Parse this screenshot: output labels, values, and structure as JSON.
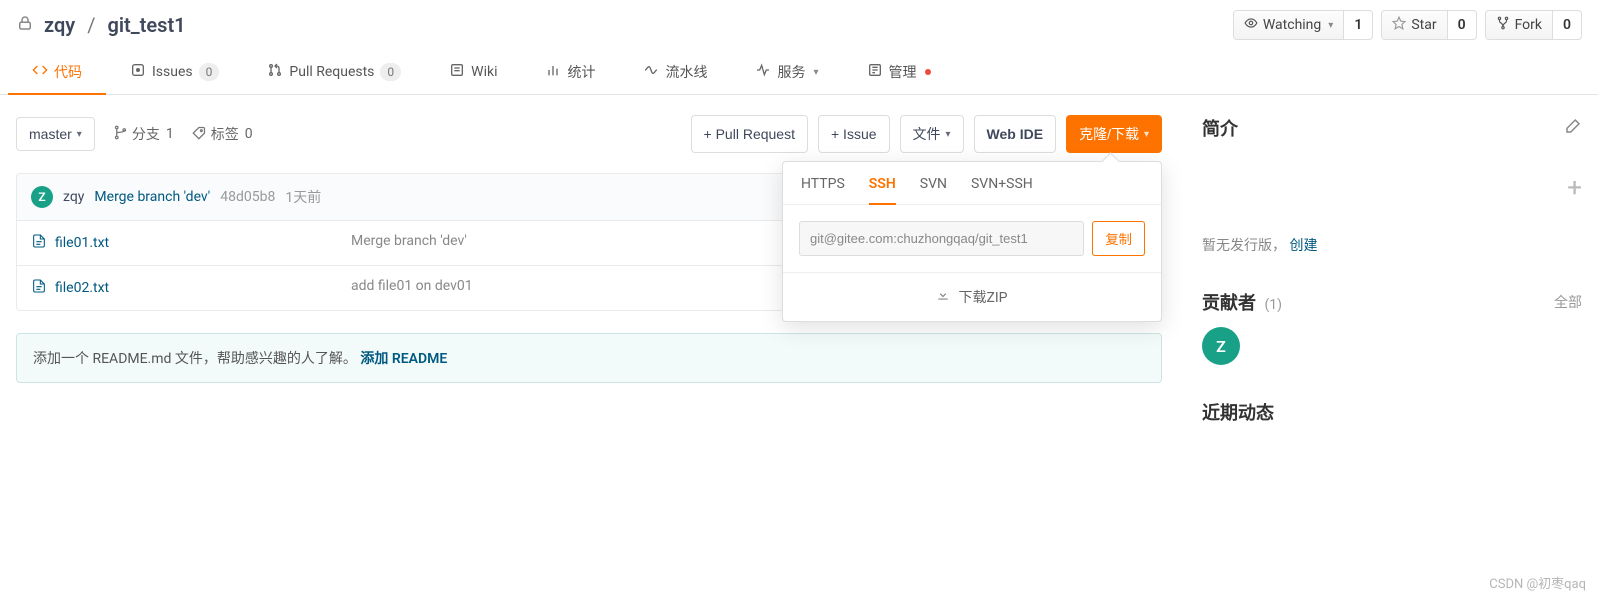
{
  "repo": {
    "owner": "zqy",
    "name": "git_test1"
  },
  "actions": {
    "watch": {
      "label": "Watching",
      "count": "1"
    },
    "star": {
      "label": "Star",
      "count": "0"
    },
    "fork": {
      "label": "Fork",
      "count": "0"
    }
  },
  "tabs": {
    "code": "代码",
    "issues": {
      "label": "Issues",
      "count": "0"
    },
    "pr": {
      "label": "Pull Requests",
      "count": "0"
    },
    "wiki": "Wiki",
    "stats": "统计",
    "pipeline": "流水线",
    "services": "服务",
    "manage": "管理"
  },
  "toolbar": {
    "branch": "master",
    "branches": {
      "label": "分支",
      "count": "1"
    },
    "tags": {
      "label": "标签",
      "count": "0"
    },
    "pull_request": "+ Pull Request",
    "issue": "+ Issue",
    "files": "文件",
    "web_ide": "Web IDE",
    "clone": "克隆/下载"
  },
  "clone_panel": {
    "tabs": {
      "https": "HTTPS",
      "ssh": "SSH",
      "svn": "SVN",
      "svn_ssh": "SVN+SSH"
    },
    "url": "git@gitee.com:chuzhongqaq/git_test1",
    "copy": "复制",
    "download_zip": "下载ZIP"
  },
  "commit": {
    "avatar_letter": "Z",
    "user": "zqy",
    "message": "Merge branch 'dev'",
    "hash": "48d05b8",
    "time": "1天前"
  },
  "files": [
    {
      "name": "file01.txt",
      "msg": "Merge branch 'dev'"
    },
    {
      "name": "file02.txt",
      "msg": "add file01 on dev01"
    }
  ],
  "readme_prompt": {
    "text": "添加一个 README.md 文件，帮助感兴趣的人了解。",
    "link": "添加 README"
  },
  "sidebar": {
    "intro": "简介",
    "release_none": "暂无发行版，",
    "release_create": "创建",
    "contributors": {
      "label": "贡献者",
      "count": "(1)",
      "all": "全部",
      "avatar_letter": "Z"
    },
    "activity": "近期动态"
  },
  "watermark": "CSDN @初枣qaq"
}
